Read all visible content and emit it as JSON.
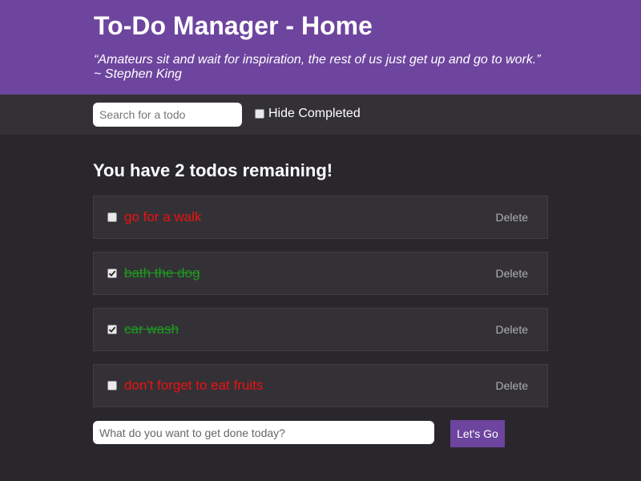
{
  "header": {
    "title": "To-Do Manager - Home",
    "quote": "“Amateurs sit and wait for inspiration, the rest of us just get up and go to work.”",
    "author": "~ Stephen King",
    "bg_color": "#6d449e"
  },
  "toolbar": {
    "search_placeholder": "Search for a todo",
    "hide_completed_label": "Hide Completed",
    "hide_completed_checked": false
  },
  "main": {
    "remaining_text": "You have 2 todos remaining!",
    "todos": [
      {
        "text": "go for a walk",
        "completed": false,
        "delete_label": "Delete"
      },
      {
        "text": "bath the dog",
        "completed": true,
        "delete_label": "Delete"
      },
      {
        "text": "car wash",
        "completed": true,
        "delete_label": "Delete"
      },
      {
        "text": "don't forget to eat fruits",
        "completed": false,
        "delete_label": "Delete"
      }
    ],
    "new_todo_placeholder": "What do you want to get done today?",
    "submit_label": "Let's Go"
  },
  "colors": {
    "accent": "#6d449e",
    "open_todo": "#ee1111",
    "completed_todo": "#1f9a1f",
    "background": "#29272c"
  },
  "icons": {
    "checkbox_checked": "checkmark-icon"
  }
}
